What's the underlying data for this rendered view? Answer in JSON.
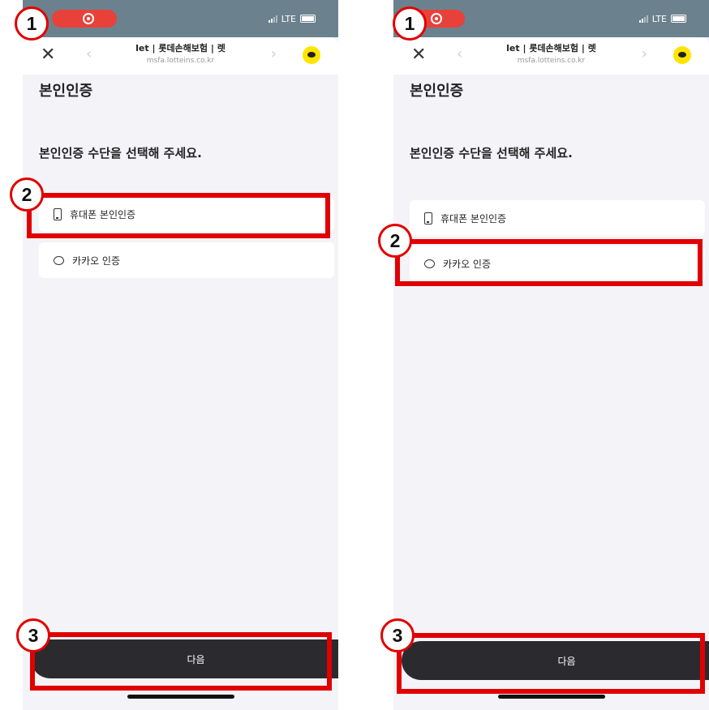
{
  "status_bar": {
    "network": "LTE"
  },
  "browser": {
    "title": "let | 롯데손해보험 | 렛",
    "url": "msfa.lotteins.co.kr",
    "close_icon": "✕",
    "back_icon": "‹",
    "forward_icon": "›"
  },
  "page": {
    "title": "본인인증",
    "prompt": "본인인증 수단을 선택해 주세요.",
    "options": [
      {
        "label": "휴대폰 본인인증",
        "icon": "mobile-phone-icon"
      },
      {
        "label": "카카오 인증",
        "icon": "chat-bubble-icon"
      }
    ],
    "next_label": "다음"
  },
  "annotations": {
    "badges": [
      "1",
      "2",
      "3"
    ],
    "highlight_color": "#e00000"
  },
  "colors": {
    "status_bar": "#6c818e",
    "record_pill": "#e8413a",
    "kakao": "#fee500",
    "next_button": "#2b2a2f"
  }
}
